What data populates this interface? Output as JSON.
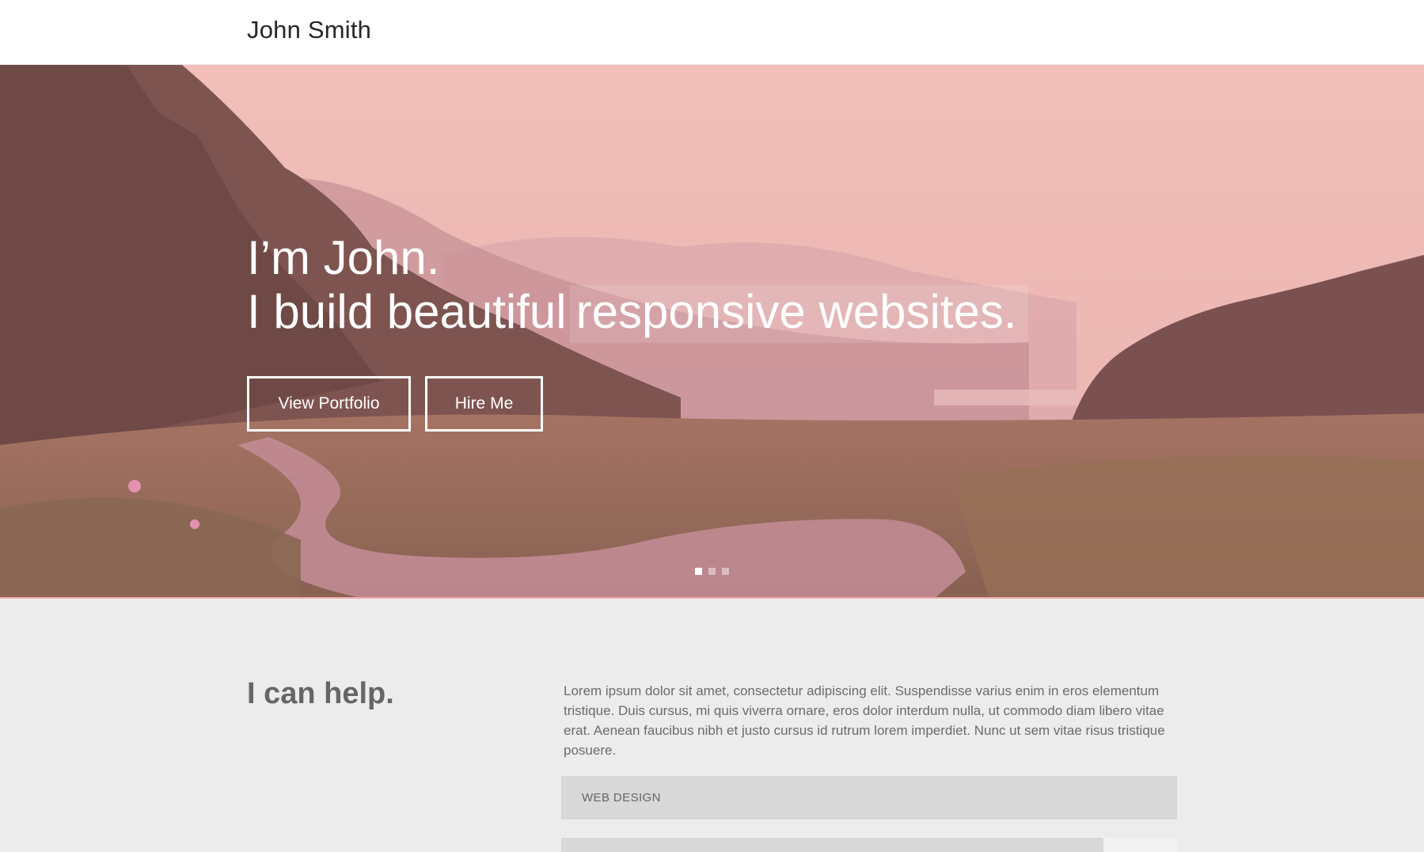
{
  "header": {
    "brand": "John Smith"
  },
  "hero": {
    "line1": "I’m John.",
    "line2_plain": "I build beautiful",
    "line2_highlight": "responsive websites.",
    "buttons": {
      "portfolio_label": "View Portfolio",
      "hire_label": "Hire Me"
    },
    "slider": {
      "count": 3,
      "active_index": 0
    }
  },
  "help": {
    "title": "I can help.",
    "body": "Lorem ipsum dolor sit amet, consectetur adipiscing elit. Suspendisse varius enim in eros elementum tristique. Duis cursus, mi quis viverra ornare, eros dolor interdum nulla, ut commodo diam libero vitae erat. Aenean faucibus nibh et justo cursus id rutrum lorem imperdiet. Nunc ut sem vitae risus tristique posuere.",
    "services": [
      {
        "label": "WEB DESIGN"
      }
    ],
    "skill_progress": 0.88
  },
  "colors": {
    "accent_pink": "#f1a8a6",
    "section_bg": "#ececec",
    "bar_gray": "#d8d8d8"
  }
}
